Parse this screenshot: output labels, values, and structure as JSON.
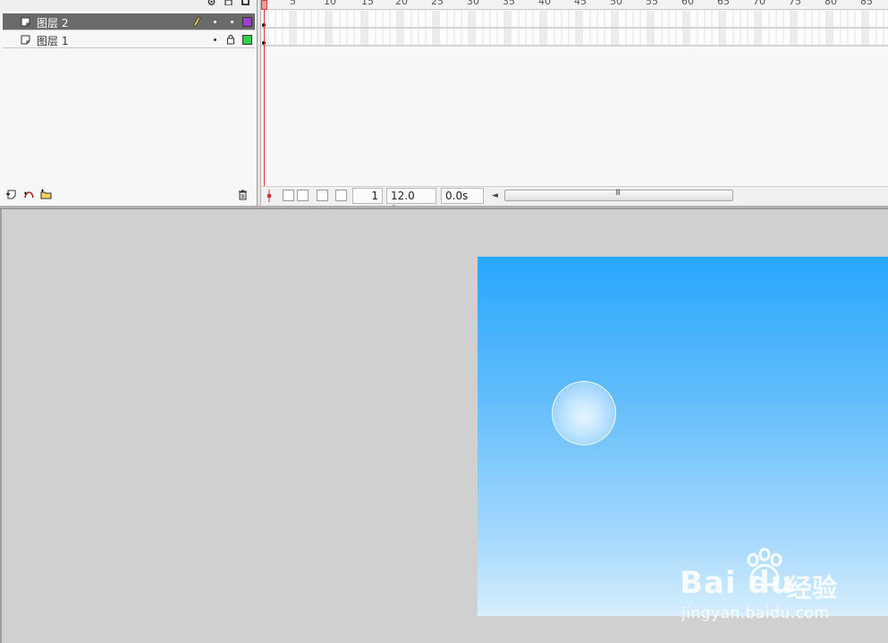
{
  "timeline": {
    "layers": [
      {
        "name": "图层 2",
        "selected": true,
        "color": "#9b3fcf",
        "locked": false
      },
      {
        "name": "图层 1",
        "selected": false,
        "color": "#2fcf4a",
        "locked": true
      }
    ],
    "ruler_ticks": [
      "5",
      "10",
      "15",
      "20",
      "25",
      "30",
      "35",
      "40",
      "45",
      "50",
      "55",
      "60",
      "65",
      "70",
      "75",
      "80",
      "85"
    ],
    "status": {
      "current_frame": "1",
      "frame_rate": "12.0 fps",
      "elapsed_time": "0.0s",
      "scroll_grip": "III"
    }
  },
  "stage": {
    "gradient_top": "#28a7fd",
    "gradient_bottom": "#d7eefd"
  },
  "watermark": {
    "brand": "Bai du",
    "jingyan": "经验",
    "url": "jingyan.baidu.com"
  }
}
